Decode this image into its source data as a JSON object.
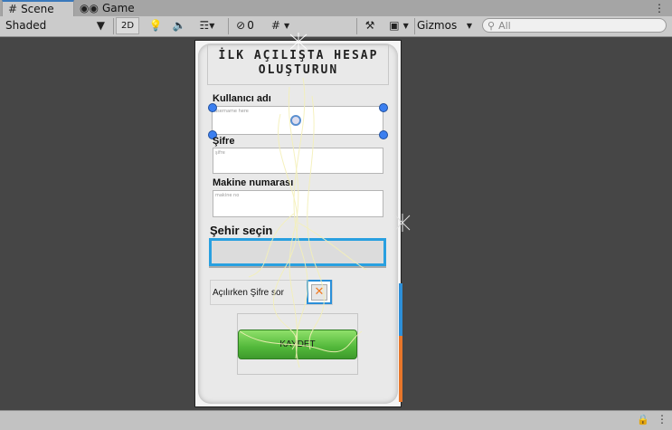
{
  "tabs": [
    {
      "label": "Scene",
      "icon": "grid-icon"
    },
    {
      "label": "Game",
      "icon": "gamepad-icon"
    }
  ],
  "toolbar": {
    "shading_mode": "Shaded",
    "mode_2d": "2D",
    "hidden_count": "0",
    "gizmos_label": "Gizmos",
    "search_placeholder": "All"
  },
  "form": {
    "title_line1": "İLK AÇILIŞTA HESAP",
    "title_line2": "OLUŞTURUN",
    "username_label": "Kullanıcı adı",
    "username_placeholder": "username here",
    "password_label": "Şifre",
    "password_placeholder": "şifre",
    "machine_label": "Makine numarası",
    "machine_placeholder": "makine no",
    "city_label": "Şehir seçin",
    "city_value": "",
    "ask_password_label": "Açılırken Şifre sor",
    "save_label": "KAYDET"
  },
  "colors": {
    "accent_blue": "#29a0e0",
    "save_green": "#52b83a",
    "scene_bg": "#464646"
  }
}
